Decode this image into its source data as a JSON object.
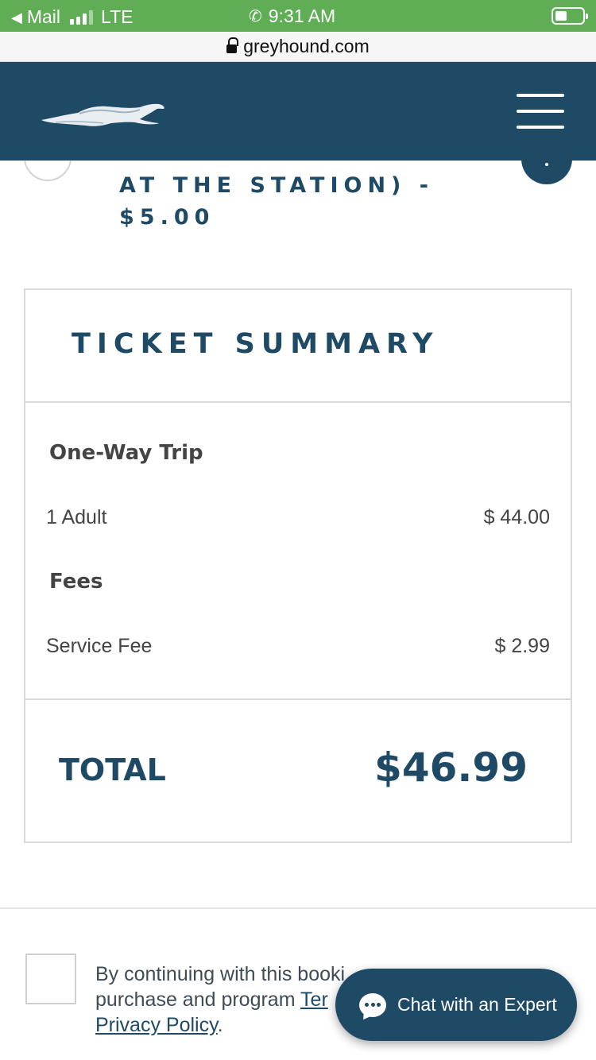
{
  "status_bar": {
    "back_label": "Mail",
    "network": "LTE",
    "time": "9:31 AM"
  },
  "url_bar": {
    "domain": "greyhound.com"
  },
  "header": {
    "logo_icon": "greyhound-dog-logo",
    "menu_icon": "hamburger-menu-icon",
    "brand_color": "#1f4a66"
  },
  "partial_option": {
    "label_line1": "AT THE STATION) -",
    "label_line2": "$5.00"
  },
  "ticket_summary": {
    "title": "TICKET SUMMARY",
    "trip_heading": "One-Way Trip",
    "passenger_label": "1 Adult",
    "passenger_amount": "$ 44.00",
    "fees_heading": "Fees",
    "fee_label": "Service Fee",
    "fee_amount": "$ 2.99",
    "total_label": "TOTAL",
    "total_amount": "$46.99"
  },
  "terms": {
    "text_line1": "By continuing with this booki",
    "text_line2": "purchase and program ",
    "terms_link": "Ter",
    "privacy_link": "Privacy Policy",
    "trailing": "."
  },
  "chat": {
    "label": "Chat with an Expert",
    "icon": "chat-bubble-icon"
  },
  "colors": {
    "status_bar": "#5fae56",
    "header": "#1f4a66",
    "accent_text": "#1f4a66"
  }
}
